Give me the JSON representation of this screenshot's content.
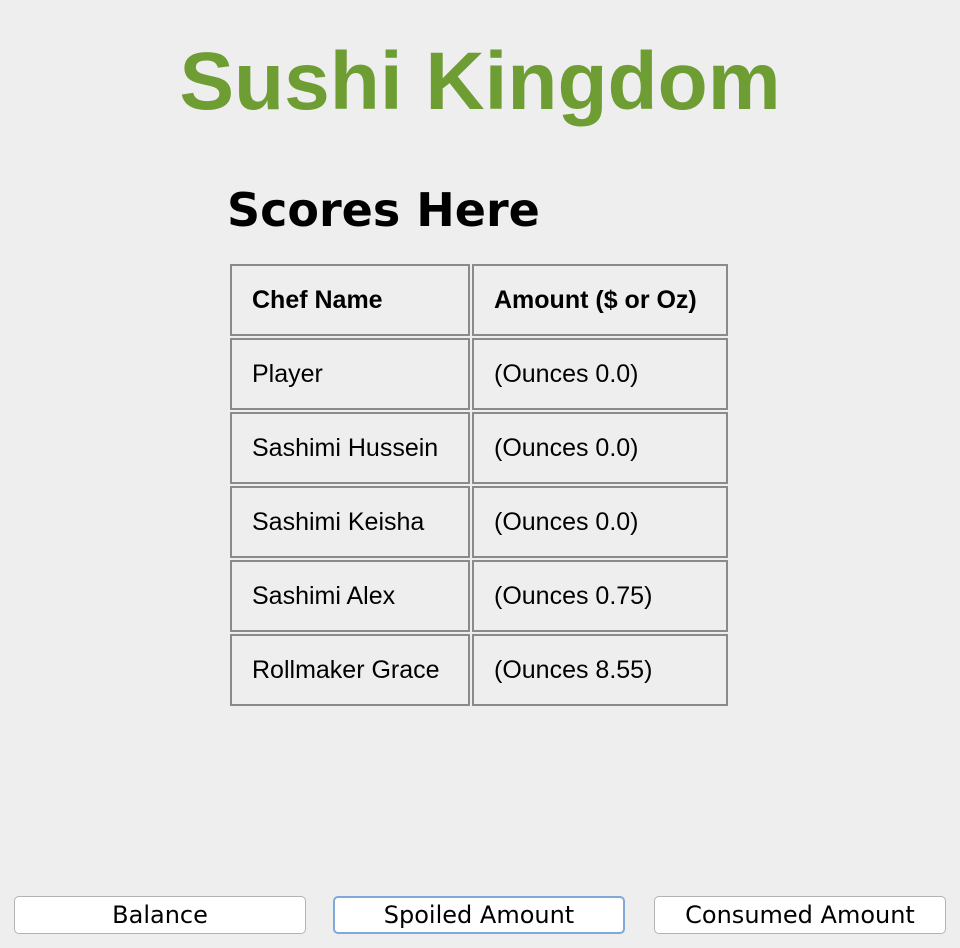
{
  "app": {
    "title": "Sushi Kingdom",
    "title_color": "#6e9d34"
  },
  "scores": {
    "heading": "Scores Here",
    "columns": [
      "Chef Name",
      "Amount ($ or Oz)"
    ],
    "rows": [
      {
        "name": "Player",
        "amount": "(Ounces 0.0)"
      },
      {
        "name": "Sashimi Hussein",
        "amount": "(Ounces 0.0)"
      },
      {
        "name": "Sashimi Keisha",
        "amount": "(Ounces 0.0)"
      },
      {
        "name": "Sashimi Alex",
        "amount": "(Ounces 0.75)"
      },
      {
        "name": "Rollmaker Grace",
        "amount": "(Ounces 8.55)"
      }
    ]
  },
  "buttons": {
    "balance": "Balance",
    "spoiled": "Spoiled Amount",
    "consumed": "Consumed Amount",
    "focused": "spoiled"
  }
}
